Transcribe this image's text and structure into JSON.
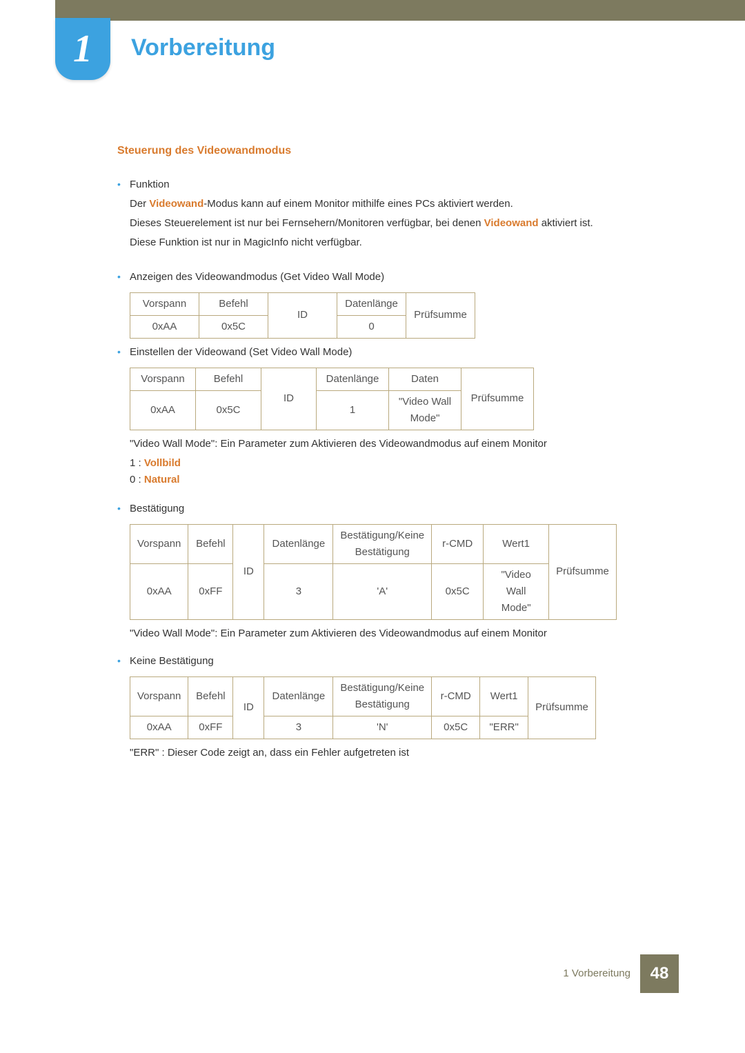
{
  "chapter": {
    "number": "1",
    "title": "Vorbereitung"
  },
  "section": {
    "title": "Steuerung des Videowandmodus"
  },
  "funktion": {
    "label": "Funktion",
    "line1a": "Der ",
    "line1_hl": "Videowand",
    "line1b": "-Modus kann auf einem Monitor mithilfe eines PCs aktiviert werden.",
    "line2a": "Dieses Steuerelement ist nur bei Fernsehern/Monitoren verfügbar, bei denen ",
    "line2_hl": "Videowand",
    "line2b": " aktiviert ist.",
    "line3": "Diese Funktion ist nur in MagicInfo nicht verfügbar."
  },
  "get_mode": {
    "label": "Anzeigen des Videowandmodus (Get Video Wall Mode)",
    "r1": {
      "c1": "Vorspann",
      "c2": "Befehl",
      "c3": "ID",
      "c4": "Datenlänge",
      "c5": "Prüfsumme"
    },
    "r2": {
      "c1": "0xAA",
      "c2": "0x5C",
      "c4": "0"
    }
  },
  "set_mode": {
    "label": "Einstellen der Videowand (Set Video Wall Mode)",
    "r1": {
      "c1": "Vorspann",
      "c2": "Befehl",
      "c3": "ID",
      "c4": "Datenlänge",
      "c5": "Daten",
      "c6": "Prüfsumme"
    },
    "r2": {
      "c1": "0xAA",
      "c2": "0x5C",
      "c4": "1",
      "c5": "\"Video Wall Mode\""
    },
    "note": "\"Video Wall Mode\": Ein Parameter zum Aktivieren des Videowandmodus auf einem Monitor",
    "v1a": "1 : ",
    "v1b": "Vollbild",
    "v0a": "0 : ",
    "v0b": "Natural"
  },
  "ack": {
    "label": "Bestätigung",
    "r1": {
      "c1": "Vorspann",
      "c2": "Befehl",
      "c3": "ID",
      "c4": "Datenlänge",
      "c5": "Bestätigung/Keine Bestätigung",
      "c6": "r-CMD",
      "c7": "Wert1",
      "c8": "Prüfsumme"
    },
    "r2": {
      "c1": "0xAA",
      "c2": "0xFF",
      "c4": "3",
      "c5": "'A'",
      "c6": "0x5C",
      "c7": "\"Video Wall Mode\""
    },
    "note": "\"Video Wall Mode\": Ein Parameter zum Aktivieren des Videowandmodus auf einem Monitor"
  },
  "nack": {
    "label": "Keine Bestätigung",
    "r1": {
      "c1": "Vorspann",
      "c2": "Befehl",
      "c3": "ID",
      "c4": "Datenlänge",
      "c5": "Bestätigung/Keine Bestätigung",
      "c6": "r-CMD",
      "c7": "Wert1",
      "c8": "Prüfsumme"
    },
    "r2": {
      "c1": "0xAA",
      "c2": "0xFF",
      "c4": "3",
      "c5": "'N'",
      "c6": "0x5C",
      "c7": "\"ERR\""
    },
    "note": "\"ERR\" : Dieser Code zeigt an, dass ein Fehler aufgetreten ist"
  },
  "footer": {
    "text": "1 Vorbereitung",
    "page": "48"
  }
}
